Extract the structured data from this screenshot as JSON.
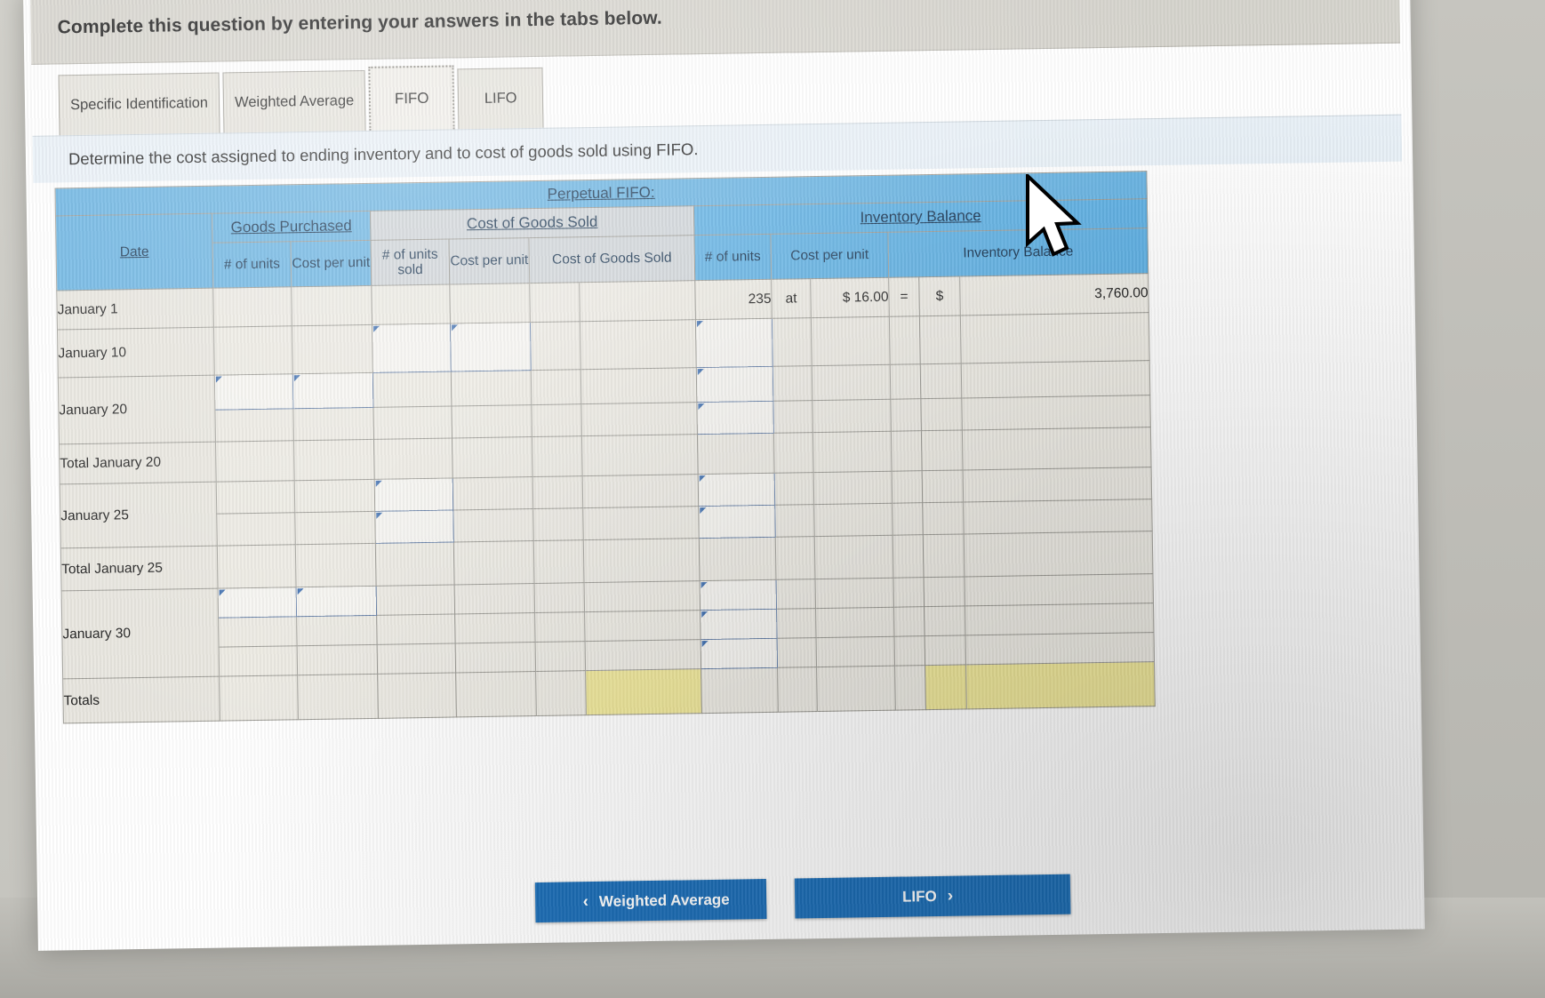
{
  "header": {
    "question_prompt": "Complete this question by entering your answers in the tabs below."
  },
  "tabs": [
    {
      "label": "Specific Identification",
      "active": false
    },
    {
      "label": "Weighted Average",
      "active": false
    },
    {
      "label": "FIFO",
      "active": true
    },
    {
      "label": "LIFO",
      "active": false
    }
  ],
  "instruction": "Determine the cost assigned to ending inventory and to cost of goods sold using FIFO.",
  "table": {
    "title": "Perpetual FIFO:",
    "group_headers": {
      "date": "Date",
      "goods_purchased": "Goods Purchased",
      "cost_of_goods_sold": "Cost of Goods Sold",
      "inventory_balance": "Inventory Balance"
    },
    "column_headers": {
      "gp_units": "# of units",
      "gp_cost_per_unit": "Cost per unit",
      "cogs_units_sold": "# of units sold",
      "cogs_cost_per_unit": "Cost per unit",
      "cogs_cost": "Cost of Goods Sold",
      "inv_units": "# of units",
      "inv_cost_per_unit": "Cost per unit",
      "inv_balance": "Inventory Balance"
    },
    "rows": [
      {
        "date": "January 1",
        "inv_units": "235",
        "at": "at",
        "inv_cost": "$ 16.00",
        "eq": "=",
        "dollar": "$",
        "inv_balance": "3,760.00"
      },
      {
        "date": "January 10",
        "inv_units": "",
        "at": "",
        "inv_cost": "",
        "eq": "",
        "dollar": "",
        "inv_balance": ""
      },
      {
        "date": "January 20",
        "inv_units": "",
        "at": "",
        "inv_cost": "",
        "eq": "",
        "dollar": "",
        "inv_balance": ""
      },
      {
        "date": "Total January 20",
        "inv_units": "",
        "at": "",
        "inv_cost": "",
        "eq": "",
        "dollar": "",
        "inv_balance": ""
      },
      {
        "date": "January 25",
        "inv_units": "",
        "at": "",
        "inv_cost": "",
        "eq": "",
        "dollar": "",
        "inv_balance": ""
      },
      {
        "date": "Total January 25",
        "inv_units": "",
        "at": "",
        "inv_cost": "",
        "eq": "",
        "dollar": "",
        "inv_balance": ""
      },
      {
        "date": "January 30",
        "inv_units": "",
        "at": "",
        "inv_cost": "",
        "eq": "",
        "dollar": "",
        "inv_balance": ""
      },
      {
        "date": "Totals",
        "inv_units": "",
        "at": "",
        "inv_cost": "",
        "eq": "",
        "dollar": "",
        "inv_balance": ""
      }
    ]
  },
  "navigation": {
    "prev_label": "Weighted Average",
    "prev_chevron": "‹",
    "next_label": "LIFO",
    "next_chevron": "›"
  },
  "colors": {
    "header_blue": "#68b3e2",
    "header_gray": "#cfd4d8",
    "button_blue": "#1d6fb8",
    "total_highlight": "#efe79a",
    "input_border": "#5d79a4"
  }
}
